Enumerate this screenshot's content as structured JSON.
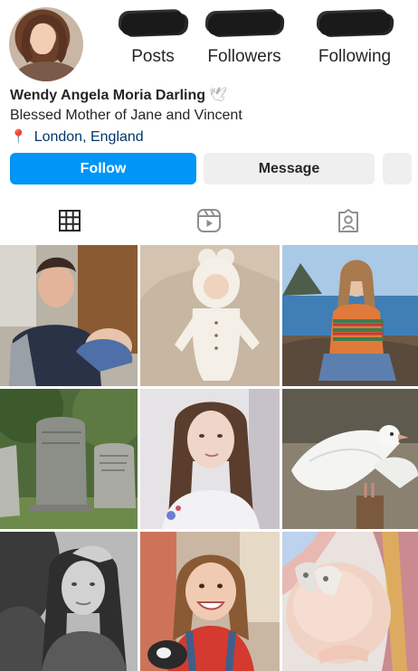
{
  "profile": {
    "name": "Wendy Angela Moria Darling",
    "name_emoji": "🕊",
    "bio": "Blessed Mother of Jane and Vincent",
    "location": "London, England",
    "location_icon": "📍"
  },
  "stats": [
    {
      "label": "Posts",
      "value_redacted": true
    },
    {
      "label": "Followers",
      "value_redacted": true
    },
    {
      "label": "Following",
      "value_redacted": true
    }
  ],
  "buttons": {
    "follow": "Follow",
    "message": "Message"
  },
  "tabs": [
    {
      "icon": "grid-icon",
      "active": true
    },
    {
      "icon": "reels-icon",
      "active": false
    },
    {
      "icon": "tagged-icon",
      "active": false
    }
  ],
  "posts": [
    {
      "subject": "man-holding-baby"
    },
    {
      "subject": "baby-in-knit-outfit"
    },
    {
      "subject": "girl-by-sea"
    },
    {
      "subject": "gravestones"
    },
    {
      "subject": "young-woman-portrait"
    },
    {
      "subject": "white-doves"
    },
    {
      "subject": "two-girls-black-and-white"
    },
    {
      "subject": "smiling-girl"
    },
    {
      "subject": "pregnant-belly-with-baby-shoes"
    }
  ],
  "colors": {
    "accent": "#0095f6",
    "text": "#262626",
    "link": "#00376b",
    "button_secondary": "#efefef"
  }
}
